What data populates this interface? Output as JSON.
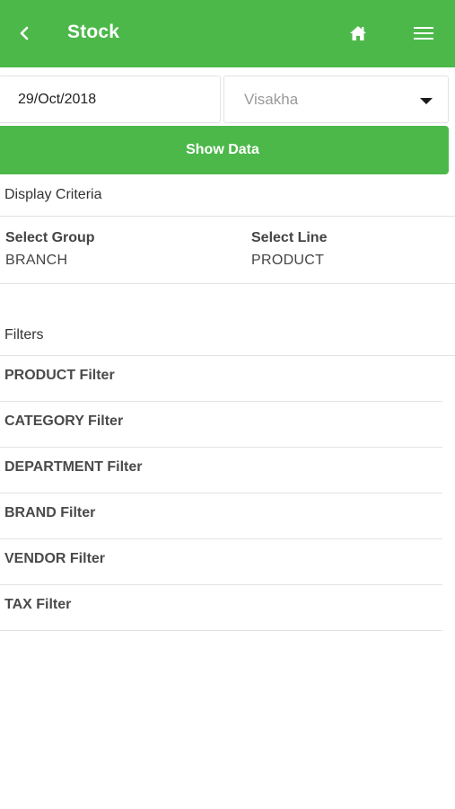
{
  "header": {
    "title": "Stock",
    "back_icon": "chevron-left-icon",
    "home_icon": "home-icon",
    "menu_icon": "hamburger-menu-icon",
    "bg_color": "#4cb84a"
  },
  "controls": {
    "date_value": "29/Oct/2018",
    "location_value": "Visakha",
    "show_data_label": "Show Data"
  },
  "display_criteria": {
    "title": "Display Criteria",
    "items": [
      {
        "label": "Select Group",
        "value": "BRANCH"
      },
      {
        "label": "Select Line",
        "value": "PRODUCT"
      }
    ]
  },
  "filters": {
    "title": "Filters",
    "items": [
      {
        "label": "PRODUCT Filter"
      },
      {
        "label": "CATEGORY Filter"
      },
      {
        "label": "DEPARTMENT Filter"
      },
      {
        "label": "BRAND Filter"
      },
      {
        "label": "VENDOR Filter"
      },
      {
        "label": "TAX Filter"
      }
    ]
  }
}
